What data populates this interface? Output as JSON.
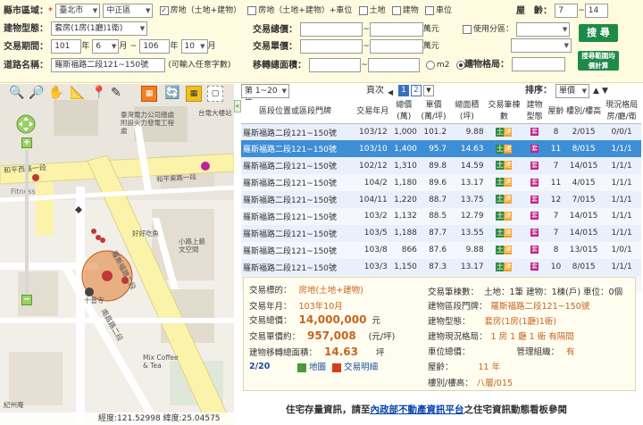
{
  "filters": {
    "county_label": "縣市區域：",
    "county_value": "臺北市",
    "district_value": "中正區",
    "types": [
      {
        "label": "房地（土地+建物）",
        "checked": true
      },
      {
        "label": "房地（土地+建物）+車位",
        "checked": false
      },
      {
        "label": "土地",
        "checked": false
      },
      {
        "label": "建物",
        "checked": false
      },
      {
        "label": "車位",
        "checked": false
      }
    ],
    "age_label": "屋　齡：",
    "age_from": "7",
    "age_to": "14",
    "building_type_label": "建物型態：",
    "building_type_value": "套房(1房(1廳)1衛)",
    "total_price_label": "交易總價：",
    "unit_price_label": "交易單價：",
    "wan_unit": "萬元",
    "use_zone_label": "使用分區：",
    "search_button": "搜 尋",
    "period_label": "交易期間：",
    "period_from_year": "101",
    "year_unit": "年",
    "period_from_month": "6",
    "month_unit": "月",
    "period_sep": "~",
    "period_to_year": "106",
    "period_to_month": "10",
    "road_label": "道路名稱：",
    "road_value": "羅斯福路二段121~150號",
    "road_hint": "(可輸入任意字數)",
    "transfer_area_label": "移轉總面積：",
    "unit_m2": "m2",
    "unit_ping": "坪",
    "building_area_label": "建物格局：",
    "avg_price_button": "搜尋範圍均價計算"
  },
  "map": {
    "labels": {
      "hospital": "臺灣電力公司總處附設火力發電工程處",
      "lib": "台電大樓站",
      "road1": "和平東路一段",
      "road2": "和平西路一段",
      "road3": "羅斯福路二段",
      "road4": "南昌路二段",
      "fitness": "Fitness",
      "mix": "Mix Coffee & Tea",
      "shiyi": "十普寺",
      "gym": "小路上藝文空間",
      "fish": "好好吃魚",
      "park": "紀州庵"
    },
    "coords": "經度:121.52998  緯度:25.04575"
  },
  "results": {
    "per_page_value": "第 1~20 筆",
    "page_label": "頁次",
    "pages": [
      "1",
      "2"
    ],
    "sort_label": "排序：",
    "sort_value": "單價",
    "headers": [
      "區段位置或區段門牌",
      "交易年月",
      "總價(萬)",
      "單價(萬/坪)",
      "總面積(坪)",
      "交易筆棟數",
      "建物型態",
      "屋齡",
      "樓別/樓高",
      "現況格局房/廳/衛"
    ],
    "rows": [
      {
        "addr": "羅斯福路二段121~150號",
        "ym": "103/12",
        "total": "1,000",
        "unit": "101.2",
        "area": "9.88",
        "age": "8",
        "floor": "2/015",
        "layout": "0/0/1"
      },
      {
        "addr": "羅斯福路二段121~150號",
        "ym": "103/10",
        "total": "1,400",
        "unit": "95.7",
        "area": "14.63",
        "age": "11",
        "floor": "8/015",
        "layout": "1/1/1"
      },
      {
        "addr": "羅斯福路二段121~150號",
        "ym": "102/12",
        "total": "1,310",
        "unit": "89.8",
        "area": "14.59",
        "age": "7",
        "floor": "14/015",
        "layout": "1/1/1"
      },
      {
        "addr": "羅斯福路二段121~150號",
        "ym": "104/2",
        "total": "1,180",
        "unit": "89.6",
        "area": "13.17",
        "age": "11",
        "floor": "4/015",
        "layout": "1/1/1"
      },
      {
        "addr": "羅斯福路二段121~150號",
        "ym": "104/11",
        "total": "1,220",
        "unit": "88.7",
        "area": "13.75",
        "age": "12",
        "floor": "7/015",
        "layout": "1/1/1"
      },
      {
        "addr": "羅斯福路二段121~150號",
        "ym": "103/2",
        "total": "1,132",
        "unit": "88.5",
        "area": "12.79",
        "age": "7",
        "floor": "14/015",
        "layout": "1/1/1"
      },
      {
        "addr": "羅斯福路二段121~150號",
        "ym": "103/5",
        "total": "1,188",
        "unit": "87.7",
        "area": "13.55",
        "age": "7",
        "floor": "14/015",
        "layout": "1/1/1"
      },
      {
        "addr": "羅斯福路二段121~150號",
        "ym": "103/8",
        "total": "866",
        "unit": "87.6",
        "area": "9.88",
        "age": "8",
        "floor": "13/015",
        "layout": "1/0/1"
      },
      {
        "addr": "羅斯福路二段121~150號",
        "ym": "103/3",
        "total": "1,150",
        "unit": "87.3",
        "area": "13.17",
        "age": "10",
        "floor": "8/015",
        "layout": "1/1/1"
      },
      {
        "addr": "羅斯福路二段121~150號",
        "ym": "103/9",
        "total": "1,239",
        "unit": "85",
        "area": "14.59",
        "age": "8",
        "floor": "6/015",
        "layout": "1/1/1"
      }
    ],
    "selected_row": 1
  },
  "detail": {
    "target_label": "交易標的：",
    "target_value": "房地(土地+建物)",
    "ym_label": "交易年月：",
    "ym_value": "103年10月",
    "total_label": "交易總價：",
    "total_value": "14,000,000",
    "total_unit": "元",
    "unit_label": "交易單價約：",
    "unit_value": "957,008",
    "unit_unit": "(元/坪)",
    "area_label": "建物移轉總面積：",
    "area_value": "14.63",
    "area_unit": "坪",
    "pager": "2/20",
    "map_link": "地圖",
    "explain_link": "交易明細",
    "count_label": "交易筆棟數：",
    "count_value": "土地：1筆 建物：1棟(戶) 車位：0個",
    "addr_label": "建物區段門牌：",
    "addr_value": "羅斯福路二段121~150號",
    "type_label": "建物型態：",
    "type_value": "套房(1房(1廳)1衛)",
    "layout_label": "建物現況格局：",
    "layout_value": "1 房 1 廳 1 衛 有隔間",
    "parking_label": "車位總價：",
    "mgmt_label": "管理組織：",
    "mgmt_value": "有",
    "age_label": "屋齡：",
    "age_value": "11 年",
    "floor_label": "樓別/樓高：",
    "floor_value": "八層/015"
  },
  "footer": {
    "text_before": "住宅存量資訊，請至",
    "link": "內政部不動產資訊平台",
    "text_after": "之住宅資訊動態看板參閱"
  },
  "colors": {
    "accent_green": "#1e8a4a",
    "highlight": "#3e8ed6",
    "form_bg": "#fffbe0",
    "detail_orange": "#c8641e"
  }
}
